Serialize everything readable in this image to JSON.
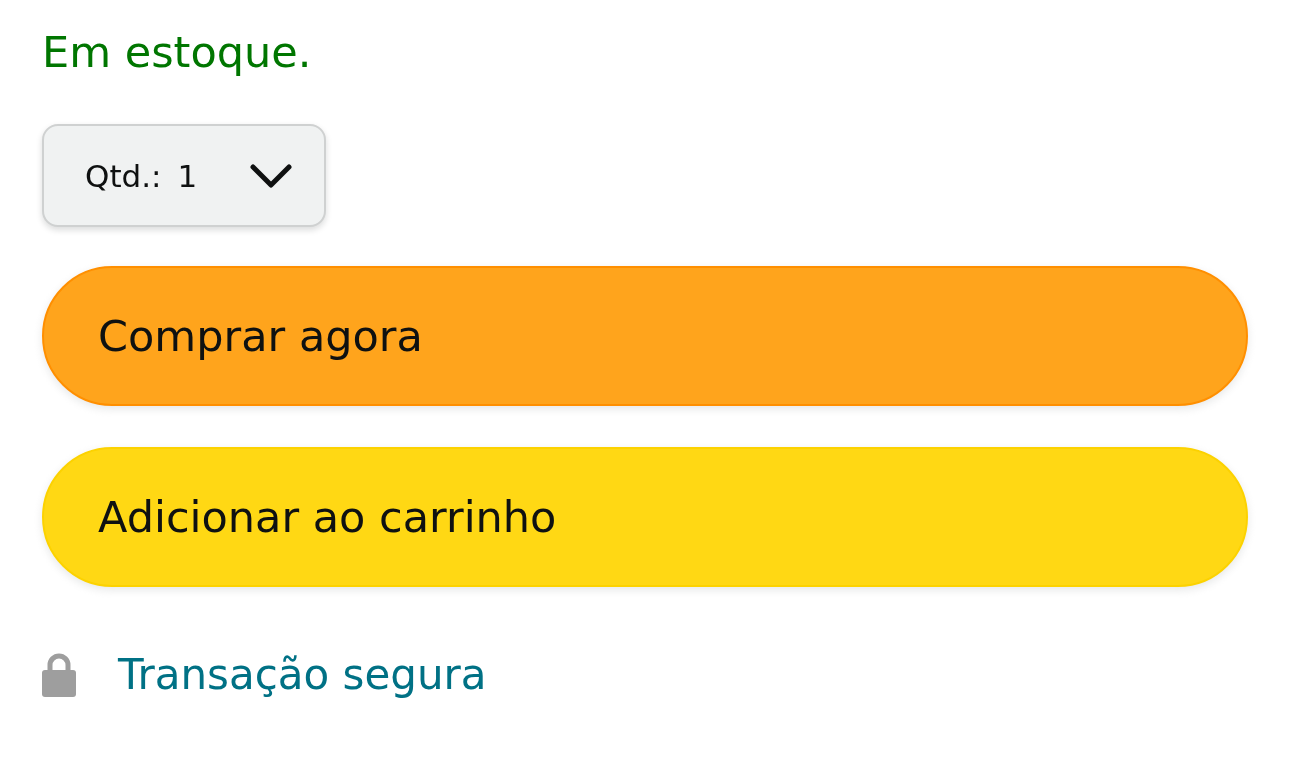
{
  "availability": "Em estoque.",
  "quantity": {
    "label": "Qtd.:",
    "value": "1"
  },
  "buttons": [
    {
      "kind": "buy",
      "label": "Comprar agora"
    },
    {
      "kind": "cart",
      "label": "Adicionar ao carrinho"
    }
  ],
  "secure_link": {
    "label": "Transação segura"
  }
}
